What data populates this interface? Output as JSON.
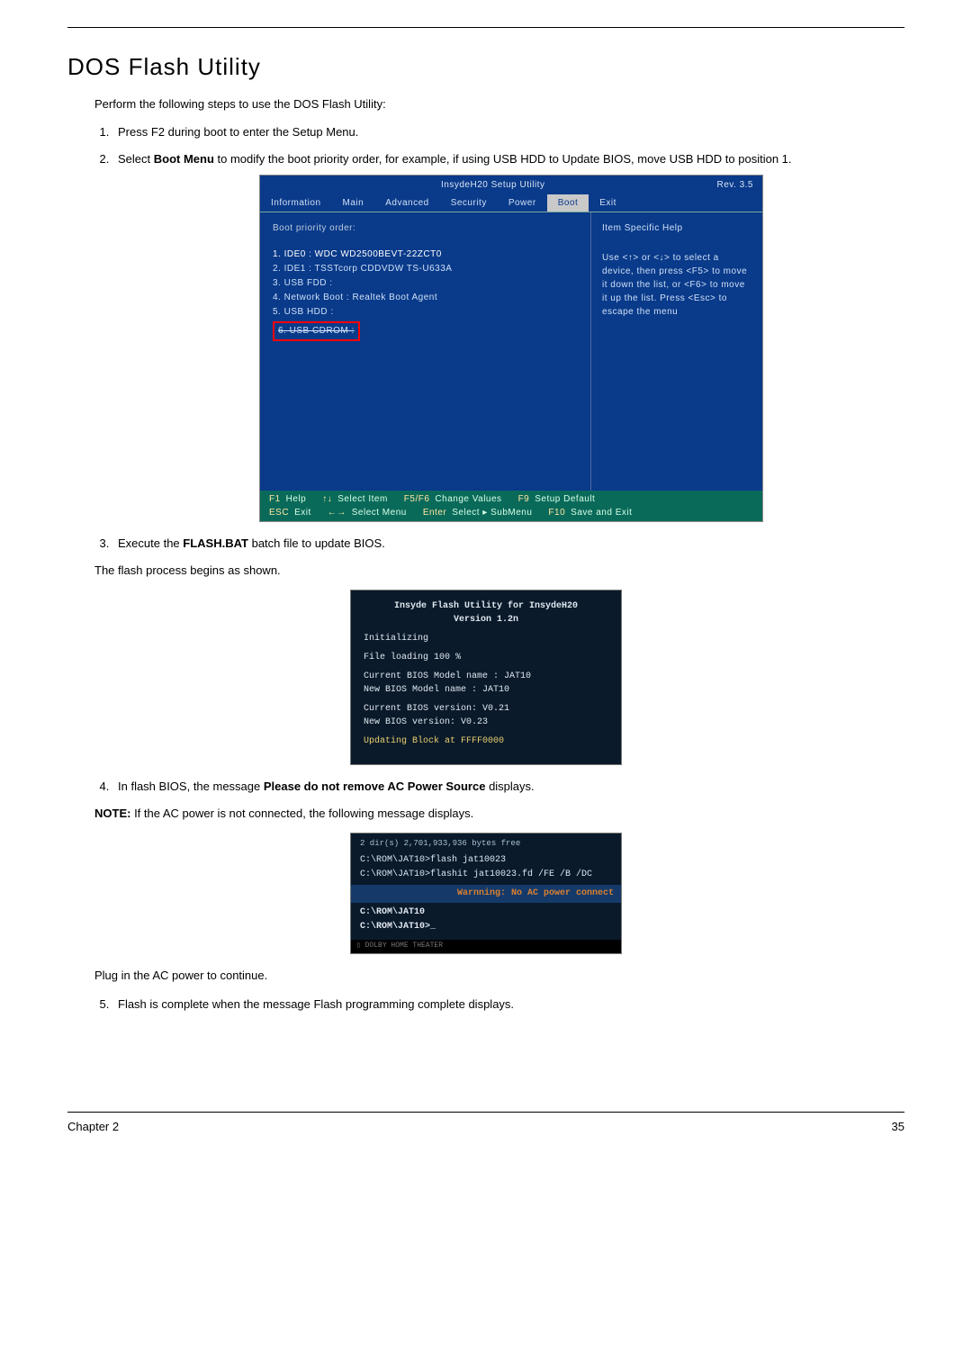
{
  "page": {
    "title": "DOS Flash Utility",
    "intro": "Perform the following steps to use the DOS Flash Utility:",
    "chapter_label": "Chapter 2",
    "page_number": "35"
  },
  "steps": {
    "s1": "Press F2 during boot to enter the Setup Menu.",
    "s2_a": "Select ",
    "s2_b": "Boot Menu",
    "s2_c": " to modify the boot priority order, for example, if using USB HDD to Update BIOS, move USB HDD to position 1.",
    "s3_a": "Execute the ",
    "s3_b": "FLASH.BAT",
    "s3_c": " batch file to update BIOS.",
    "s3_sub": "The flash process begins as shown.",
    "s4_a": "In flash BIOS, the message ",
    "s4_b": "Please do not remove AC Power Source",
    "s4_c": " displays.",
    "s4_note_a": "NOTE:",
    "s4_note_b": " If the AC power is not connected, the following message displays.",
    "s4_sub": "Plug in the AC power to continue.",
    "s5": "Flash is complete when the message Flash programming complete displays."
  },
  "bios": {
    "title": "InsydeH20 Setup Utility",
    "rev": "Rev. 3.5",
    "tabs": [
      "Information",
      "Main",
      "Advanced",
      "Security",
      "Power",
      "Boot",
      "Exit"
    ],
    "left_heading": "Boot priority order:",
    "boot_items": [
      "1. IDE0 : WDC WD2500BEVT-22ZCT0",
      "2. IDE1 : TSSTcorp CDDVDW TS-U633A",
      "3. USB FDD :",
      "4. Network Boot : Realtek Boot Agent",
      "5. USB HDD :",
      "6. USB CDROM :"
    ],
    "help_title": "Item Specific Help",
    "help_body": "Use <↑> or <↓> to select a device, then press <F5> to move it down the list, or <F6> to move it up the list. Press <Esc> to escape the menu",
    "footer": {
      "f1": "F1",
      "f1t": "Help",
      "arrud": "↑↓",
      "arrud_t": "Select Item",
      "f5f6": "F5/F6",
      "f5f6_t": "Change Values",
      "f9": "F9",
      "f9_t": "Setup Default",
      "esc": "ESC",
      "esc_t": "Exit",
      "arrlr": "←→",
      "arrlr_t": "Select Menu",
      "enter": "Enter",
      "enter_t": "Select ▸ SubMenu",
      "f10": "F10",
      "f10_t": "Save and Exit"
    }
  },
  "dos1": {
    "l1": "Insyde Flash Utility for InsydeH20",
    "l2": "Version 1.2n",
    "l3": "Initializing",
    "l4": "File loading    100 %",
    "l5a": "Current BIOS Model name : JAT10",
    "l5b": "New     BIOS Model name : JAT10",
    "l6a": "Current BIOS version: V0.21",
    "l6b": "New     BIOS version: V0.23",
    "l7": "Updating Block at FFFF0000"
  },
  "dos2": {
    "top": "2 dir(s)   2,701,933,936 bytes free",
    "cmd1": "C:\\ROM\\JAT10>flash jat10023",
    "cmd2": "C:\\ROM\\JAT10>flashit jat10023.fd /FE /B /DC",
    "warn": "Warnning: No AC power connect",
    "prompt1": "C:\\ROM\\JAT10",
    "prompt2": "C:\\ROM\\JAT10>_",
    "strip": "▯ DOLBY HOME THEATER"
  }
}
